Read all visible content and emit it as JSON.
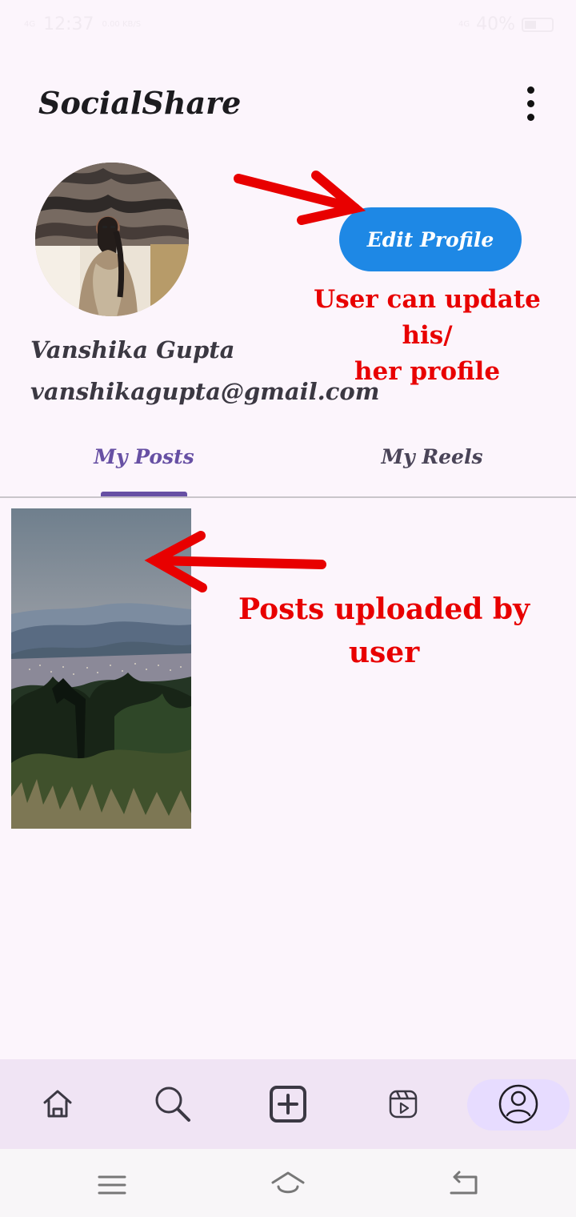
{
  "status_bar": {
    "network_left": "4G",
    "time": "12:37",
    "data_speed": "0.00 KB/S",
    "network_right": "4G",
    "battery": "40%"
  },
  "header": {
    "title": "SocialShare"
  },
  "profile": {
    "name": "Vanshika Gupta",
    "email": "vanshikagupta@gmail.com",
    "edit_button_label": "Edit Profile"
  },
  "annotations": {
    "profile_note_line1": "User can update his/",
    "profile_note_line2": "her profile",
    "posts_note_line1": "Posts uploaded by",
    "posts_note_line2": "user",
    "annotation_color": "#e80000"
  },
  "tabs": [
    {
      "label": "My Posts",
      "active": true
    },
    {
      "label": "My Reels",
      "active": false
    }
  ],
  "bottom_nav": [
    {
      "icon": "home-icon"
    },
    {
      "icon": "search-icon"
    },
    {
      "icon": "add-icon"
    },
    {
      "icon": "reels-icon"
    },
    {
      "icon": "profile-icon",
      "active": true
    }
  ],
  "colors": {
    "accent": "#6750a4",
    "button": "#1e88e5",
    "background": "#fcf5fc"
  }
}
